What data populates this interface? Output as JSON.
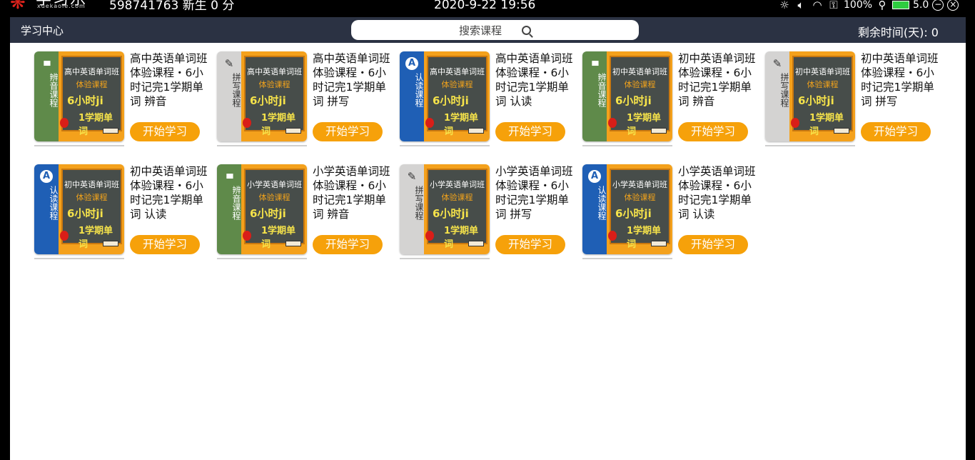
{
  "topbar": {
    "logo_mark": "❋",
    "logo_text": "学习乐",
    "logo_domain": "xuekaole.com",
    "user_info": "598741763 新生 0 分",
    "clock": "2020-9-22 19:56",
    "battery_text": "100%",
    "version": "5.0",
    "icons": [
      "brightness-icon",
      "volume-icon",
      "wifi-icon",
      "network-icon",
      "location-icon",
      "battery-icon",
      "minimize-icon",
      "close-icon"
    ]
  },
  "header": {
    "title": "学习中心",
    "search_placeholder": "搜索课程",
    "remaining_label": "剩余时间(天): 0"
  },
  "board_text": {
    "line1_high": "高中英语单词班",
    "line1_junior": "初中英语单词班",
    "line1_primary": "小学英语单词班",
    "line2": "体验课程",
    "line3": "6小时ji",
    "line4": "1学期单词"
  },
  "courses": [
    {
      "category": "辨音课程",
      "icon": "bar-chart-icon",
      "color": "green",
      "board_line1": "高中英语单词班",
      "title": "高中英语单词班体验课程・6小时记完1学期单词 辨音",
      "button": "开始学习"
    },
    {
      "category": "拼写课程",
      "icon": "pencil-icon",
      "color": "grey",
      "board_line1": "高中英语单词班",
      "title": "高中英语单词班体验课程・6小时记完1学期单词 拼写",
      "button": "开始学习"
    },
    {
      "category": "认读课程",
      "icon": "letter-a-icon",
      "color": "blue",
      "board_line1": "高中英语单词班",
      "title": "高中英语单词班体验课程・6小时记完1学期单词 认读",
      "button": "开始学习"
    },
    {
      "category": "辨音课程",
      "icon": "bar-chart-icon",
      "color": "green",
      "board_line1": "初中英语单词班",
      "title": "初中英语单词班体验课程・6小时记完1学期单词 辨音",
      "button": "开始学习"
    },
    {
      "category": "拼写课程",
      "icon": "pencil-icon",
      "color": "grey",
      "board_line1": "初中英语单词班",
      "title": "初中英语单词班体验课程・6小时记完1学期单词 拼写",
      "button": "开始学习"
    },
    {
      "category": "认读课程",
      "icon": "letter-a-icon",
      "color": "blue",
      "board_line1": "初中英语单词班",
      "title": "初中英语单词班体验课程・6小时记完1学期单词 认读",
      "button": "开始学习"
    },
    {
      "category": "辨音课程",
      "icon": "bar-chart-icon",
      "color": "green",
      "board_line1": "小学英语单词班",
      "title": "小学英语单词班体验课程・6小时记完1学期单词 辨音",
      "button": "开始学习"
    },
    {
      "category": "拼写课程",
      "icon": "pencil-icon",
      "color": "grey",
      "board_line1": "小学英语单词班",
      "title": "小学英语单词班体验课程・6小时记完1学期单词 拼写",
      "button": "开始学习"
    },
    {
      "category": "认读课程",
      "icon": "letter-a-icon",
      "color": "blue",
      "board_line1": "小学英语单词班",
      "title": "小学英语单词班体验课程・6小时记完1学期单词 认读",
      "button": "开始学习"
    }
  ],
  "colors": {
    "header_bg": "#2b3243",
    "button": "#f6a10a",
    "green": "#5f8a4a",
    "blue": "#1f5fb5",
    "grey": "#d4d3d2",
    "board": "#f4a11c"
  }
}
